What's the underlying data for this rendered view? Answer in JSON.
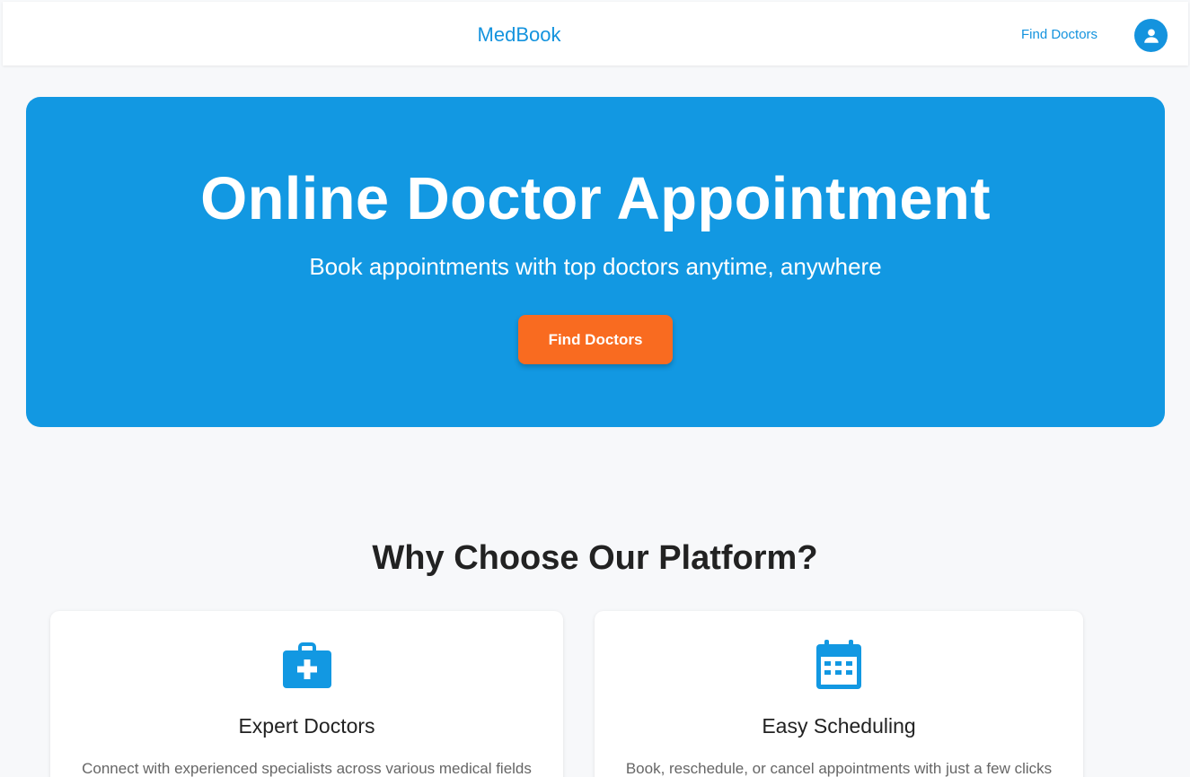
{
  "nav": {
    "brand": "MedBook",
    "link": "Find Doctors",
    "avatar_icon": "user-icon"
  },
  "hero": {
    "title": "Online Doctor Appointment",
    "subtitle": "Book appointments with top doctors anytime, anywhere",
    "button": "Find Doctors"
  },
  "features": {
    "title": "Why Choose Our Platform?",
    "cards": [
      {
        "icon": "medical-kit-icon",
        "title": "Expert Doctors",
        "description": "Connect with experienced specialists across various medical fields"
      },
      {
        "icon": "calendar-icon",
        "title": "Easy Scheduling",
        "description": "Book, reschedule, or cancel appointments with just a few clicks"
      }
    ]
  },
  "colors": {
    "primary": "#1298e2",
    "accent": "#f96b20",
    "background": "#f7f8fa"
  }
}
